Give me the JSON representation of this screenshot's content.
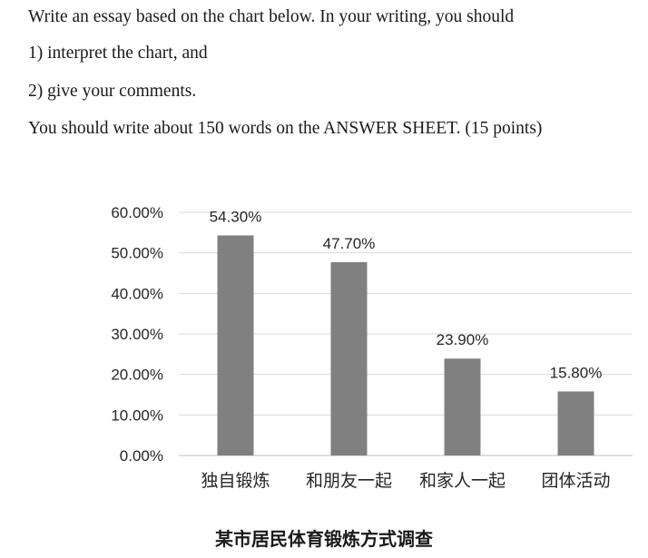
{
  "prompt": {
    "line1": "Write an essay based on the chart below. In your writing, you should",
    "line2": "1) interpret the chart, and",
    "line3": "2) give your comments.",
    "line4": "You should write about 150 words on the ANSWER SHEET. (15 points)"
  },
  "chart_data": {
    "type": "bar",
    "title": "某市居民体育锻炼方式调查",
    "categories": [
      "独自锻炼",
      "和朋友一起",
      "和家人一起",
      "团体活动"
    ],
    "values": [
      54.3,
      47.7,
      23.9,
      15.8
    ],
    "value_labels": [
      "54.30%",
      "47.70%",
      "23.90%",
      "15.80%"
    ],
    "y_ticks": [
      "0.00%",
      "10.00%",
      "20.00%",
      "30.00%",
      "40.00%",
      "50.00%",
      "60.00%"
    ],
    "ylim": [
      0,
      60
    ],
    "grid": true,
    "bar_color": "#808080",
    "grid_color": "#d9d9d9",
    "xlabel": "",
    "ylabel": ""
  }
}
